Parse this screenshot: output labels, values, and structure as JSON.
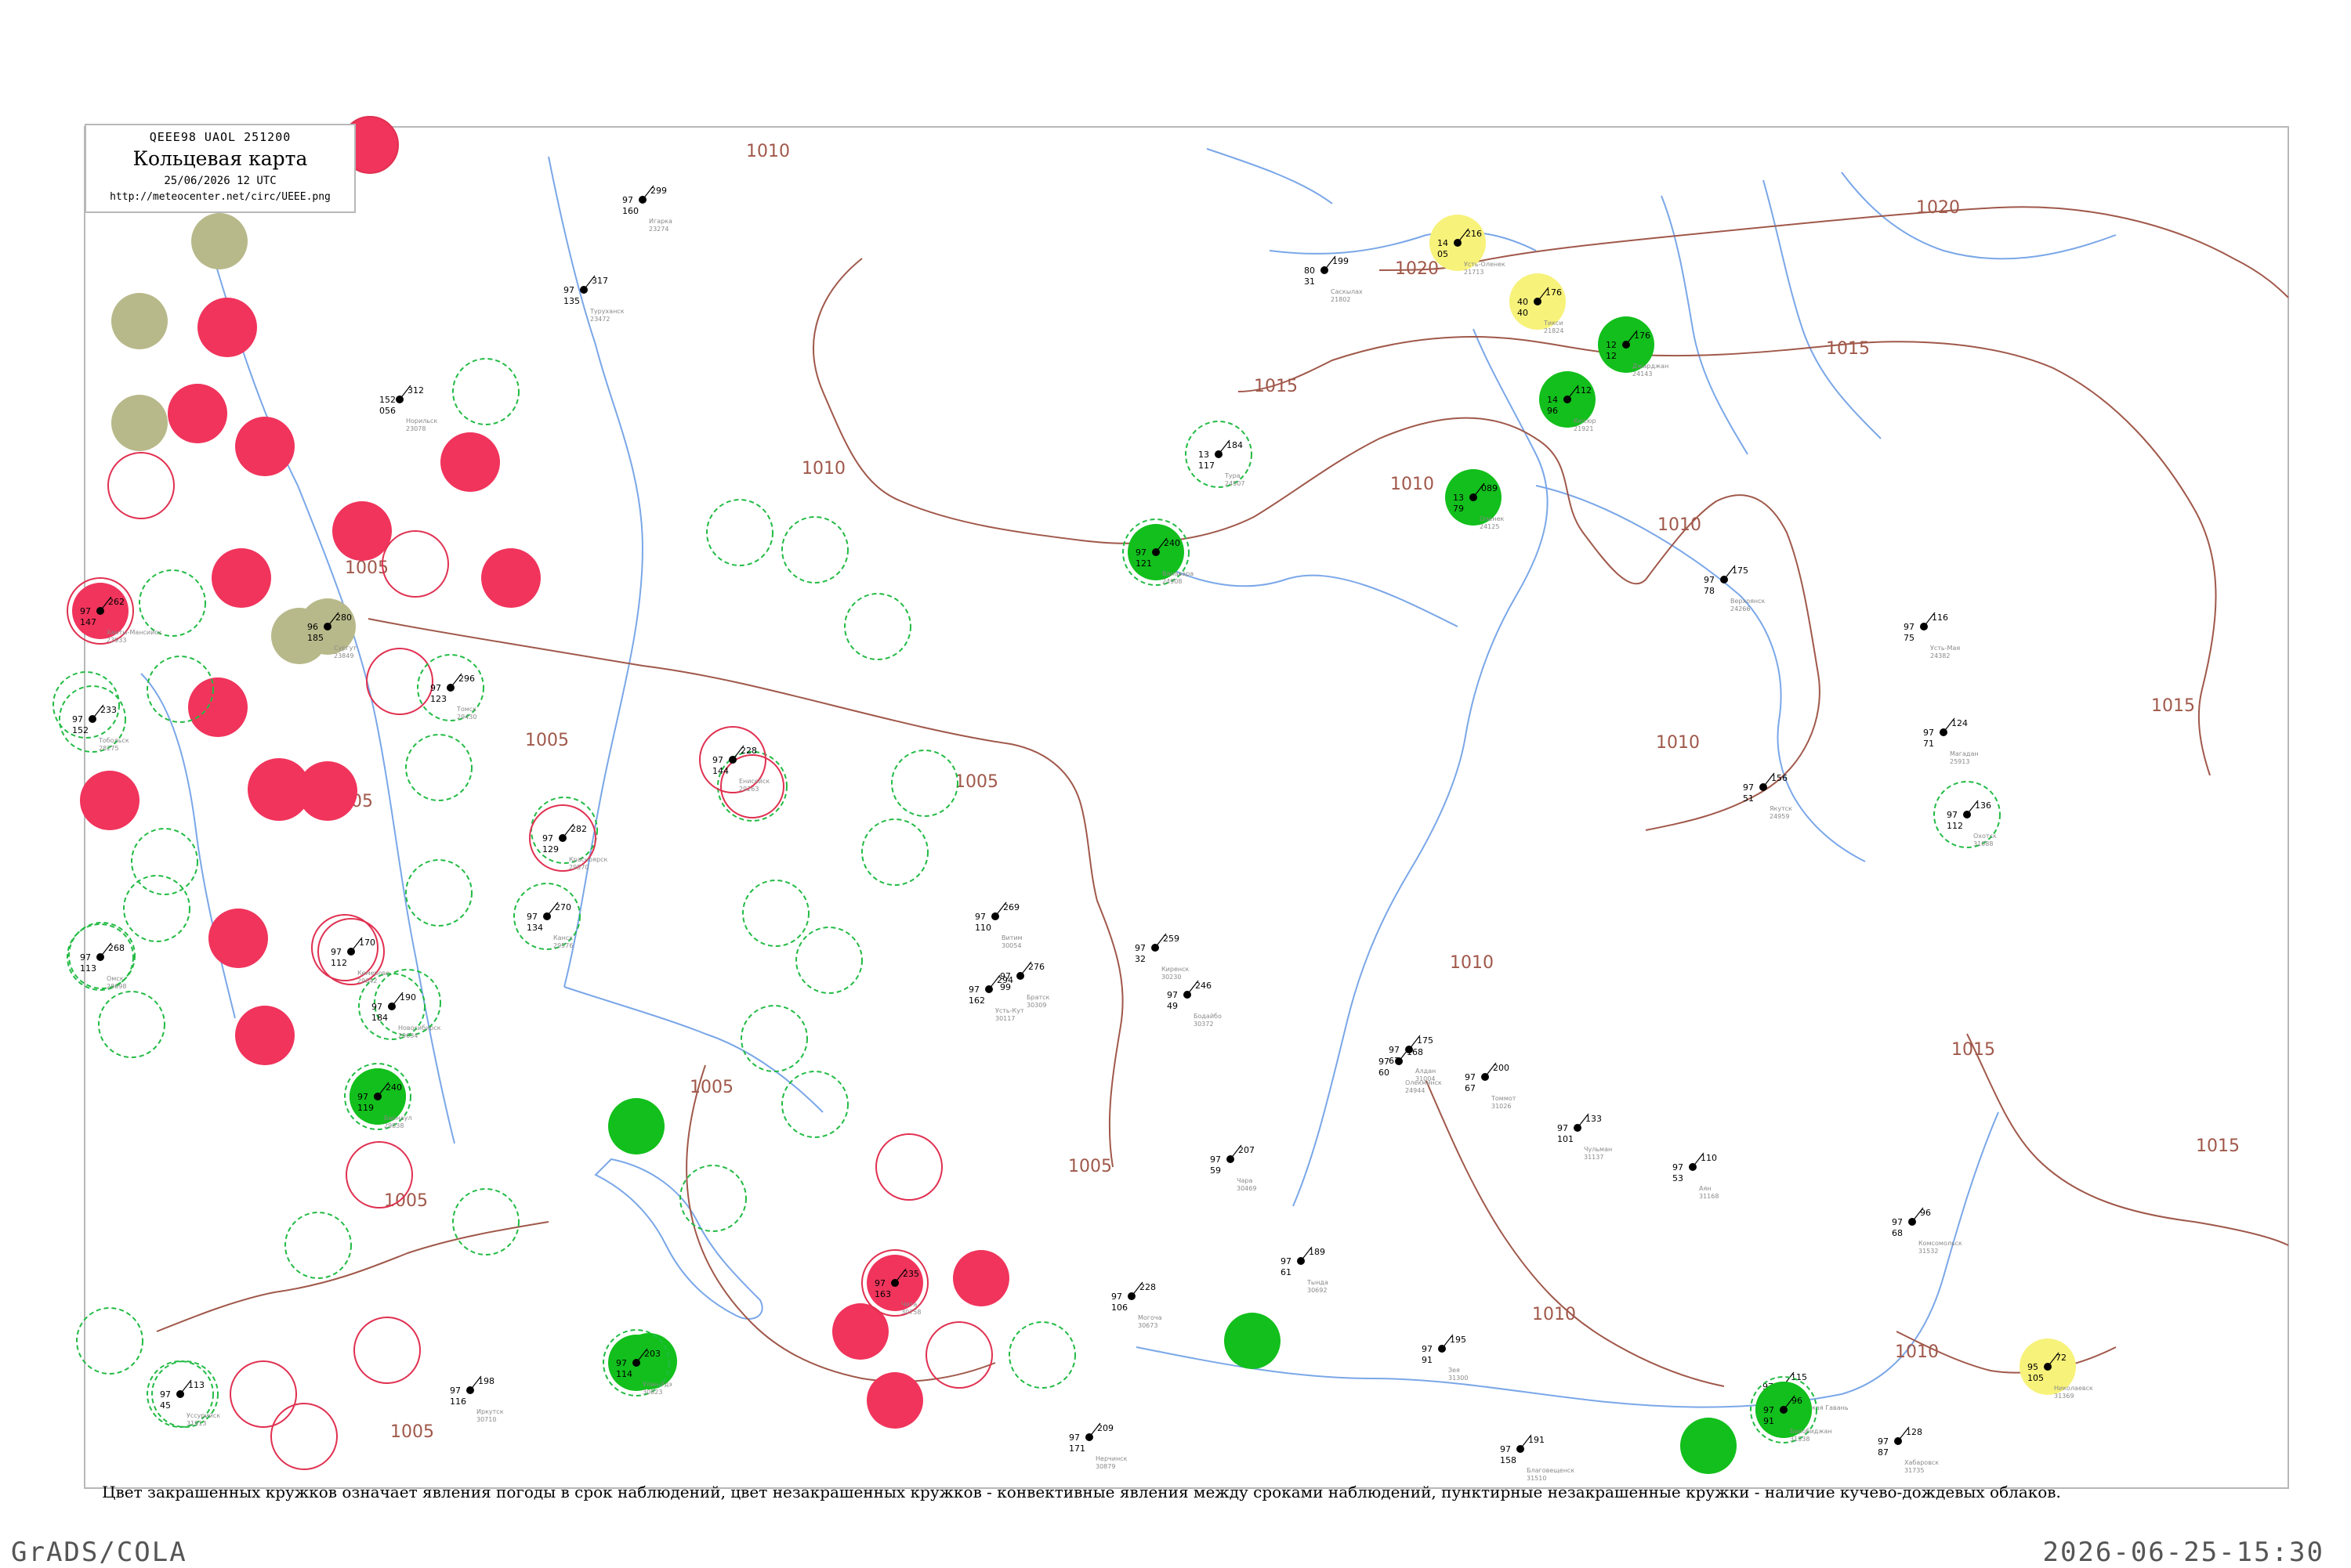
{
  "header": {
    "code_line": "QEEE98  UAOL  251200",
    "title": "Кольцевая карта",
    "date": "25/06/2026 12 UTC",
    "url": "http://meteocenter.net/circ/UEEE.png"
  },
  "caption": "Цвет закрашенных кружков означает явления погоды в срок наблюдений, цвет незакрашенных кружков - конвективные явления между сроками наблюдений, пунктирные незакрашенные кружки - наличие кучево-дождевых облаков.",
  "footer": {
    "left": "GrADS/COLA",
    "right": "2026-06-25-15:30"
  },
  "colors": {
    "isobar": "#a0584a",
    "river": "#7aa7e8",
    "thunder_fill": "#f0345c",
    "rain_fill": "#12bf1c",
    "haze_fill": "#b8b98a",
    "fog_fill": "#f7f27a",
    "cb_ring": "#22bb44",
    "conv_ring": "#e03050",
    "frame": "#b8b8b8"
  },
  "isobar_labels": [
    "1005",
    "1005",
    "1005",
    "1005",
    "1005",
    "1005",
    "1005",
    "1005",
    "1010",
    "1010",
    "1010",
    "1010",
    "1010",
    "1010",
    "1010",
    "1010",
    "1010",
    "1010",
    "1015",
    "1015",
    "1015",
    "1015",
    "1015",
    "1020",
    "1020"
  ],
  "stations": [
    {
      "name": "Саскылах",
      "id": "21802",
      "pres": "199",
      "temp": "80",
      "dew": "31",
      "fill": "none",
      "ring": "none"
    },
    {
      "name": "Усть-Оленек",
      "id": "21713",
      "pres": "216",
      "temp": "14",
      "dew": "05",
      "fill": "fog",
      "ring": "none"
    },
    {
      "name": "Тикси",
      "id": "21824",
      "pres": "176",
      "temp": "40",
      "dew": "40",
      "fill": "fog",
      "ring": "none"
    },
    {
      "name": "Джарджан",
      "id": "24143",
      "pres": "176",
      "temp": "12",
      "dew": "12",
      "fill": "rain",
      "ring": "none"
    },
    {
      "name": "Кюсюр",
      "id": "21921",
      "pres": "112",
      "temp": "14",
      "dew": "96",
      "fill": "rain",
      "ring": "none"
    },
    {
      "name": "Оленек",
      "id": "24125",
      "pres": "089",
      "temp": "13",
      "dew": "79",
      "fill": "rain",
      "ring": "none"
    },
    {
      "name": "Тура",
      "id": "24507",
      "pres": "184",
      "temp": "13",
      "dew": "117",
      "fill": "none",
      "ring": "cb"
    },
    {
      "name": "Ванавара",
      "id": "24908",
      "pres": "240",
      "temp": "97",
      "dew": "121",
      "fill": "rain",
      "ring": "cb"
    },
    {
      "name": "Верхоянск",
      "id": "24266",
      "pres": "175",
      "temp": "97",
      "dew": "78",
      "fill": "none",
      "ring": "none"
    },
    {
      "name": "Усть-Мая",
      "id": "24382",
      "pres": "116",
      "temp": "97",
      "dew": "75",
      "fill": "none",
      "ring": "none"
    },
    {
      "name": "Якутск",
      "id": "24959",
      "pres": "156",
      "temp": "97",
      "dew": "51",
      "fill": "none",
      "ring": "none"
    },
    {
      "name": "Олекминск",
      "id": "24944",
      "pres": "168",
      "temp": "97",
      "dew": "60",
      "fill": "none",
      "ring": "none"
    },
    {
      "name": "Витим",
      "id": "30054",
      "pres": "269",
      "temp": "97",
      "dew": "110",
      "fill": "none",
      "ring": "none"
    },
    {
      "name": "Киренск",
      "id": "30230",
      "pres": "259",
      "temp": "97",
      "dew": "32",
      "fill": "none",
      "ring": "none"
    },
    {
      "name": "Бодайбо",
      "id": "30372",
      "pres": "246",
      "temp": "97",
      "dew": "49",
      "fill": "none",
      "ring": "none"
    },
    {
      "name": "Чара",
      "id": "30469",
      "pres": "207",
      "temp": "97",
      "dew": "59",
      "fill": "none",
      "ring": "none"
    },
    {
      "name": "Алдан",
      "id": "31004",
      "pres": "175",
      "temp": "97",
      "dew": "67",
      "fill": "none",
      "ring": "none"
    },
    {
      "name": "Томмот",
      "id": "31026",
      "pres": "200",
      "temp": "97",
      "dew": "67",
      "fill": "none",
      "ring": "none"
    },
    {
      "name": "Чульман",
      "id": "31137",
      "pres": "133",
      "temp": "97",
      "dew": "101",
      "fill": "none",
      "ring": "none"
    },
    {
      "name": "Аян",
      "id": "31168",
      "pres": "110",
      "temp": "97",
      "dew": "53",
      "fill": "none",
      "ring": "none"
    },
    {
      "name": "Охотск",
      "id": "31088",
      "pres": "136",
      "temp": "97",
      "dew": "112",
      "fill": "none",
      "ring": "cb"
    },
    {
      "name": "Магадан",
      "id": "25913",
      "pres": "124",
      "temp": "97",
      "dew": "71",
      "fill": "none",
      "ring": "none"
    },
    {
      "name": "Николаевск",
      "id": "31369",
      "pres": "72",
      "temp": "95",
      "dew": "105",
      "fill": "fog",
      "ring": "none"
    },
    {
      "name": "Норильск",
      "id": "23078",
      "pres": "312",
      "temp": "152",
      "dew": "056",
      "fill": "none",
      "ring": "none"
    },
    {
      "name": "Игарка",
      "id": "23274",
      "pres": "299",
      "temp": "97",
      "dew": "160",
      "fill": "none",
      "ring": "none"
    },
    {
      "name": "Туруханск",
      "id": "23472",
      "pres": "317",
      "temp": "97",
      "dew": "135",
      "fill": "none",
      "ring": "none"
    },
    {
      "name": "Ханты-Мансийск",
      "id": "23933",
      "pres": "262",
      "temp": "97",
      "dew": "147",
      "fill": "thunder",
      "ring": "conv"
    },
    {
      "name": "Сургут",
      "id": "23849",
      "pres": "280",
      "temp": "96",
      "dew": "185",
      "fill": "haze",
      "ring": "none"
    },
    {
      "name": "Тобольск",
      "id": "28275",
      "pres": "233",
      "temp": "97",
      "dew": "152",
      "fill": "none",
      "ring": "cb"
    },
    {
      "name": "Омск",
      "id": "28698",
      "pres": "268",
      "temp": "97",
      "dew": "113",
      "fill": "none",
      "ring": "cb"
    },
    {
      "name": "Новосибирск",
      "id": "29634",
      "pres": "190",
      "temp": "97",
      "dew": "184",
      "fill": "none",
      "ring": "cb"
    },
    {
      "name": "Барнаул",
      "id": "29838",
      "pres": "240",
      "temp": "97",
      "dew": "119",
      "fill": "rain",
      "ring": "cb"
    },
    {
      "name": "Кемерово",
      "id": "29642",
      "pres": "170",
      "temp": "97",
      "dew": "112",
      "fill": "none",
      "ring": "conv"
    },
    {
      "name": "Томск",
      "id": "29430",
      "pres": "296",
      "temp": "97",
      "dew": "123",
      "fill": "none",
      "ring": "cb"
    },
    {
      "name": "Красноярск",
      "id": "29570",
      "pres": "282",
      "temp": "97",
      "dew": "129",
      "fill": "none",
      "ring": "conv"
    },
    {
      "name": "Канск",
      "id": "29576",
      "pres": "270",
      "temp": "97",
      "dew": "134",
      "fill": "none",
      "ring": "cb"
    },
    {
      "name": "Енисейск",
      "id": "29263",
      "pres": "228",
      "temp": "97",
      "dew": "144",
      "fill": "none",
      "ring": "conv"
    },
    {
      "name": "Иркутск",
      "id": "30710",
      "pres": "198",
      "temp": "97",
      "dew": "116",
      "fill": "none",
      "ring": "none"
    },
    {
      "name": "Улан-Удэ",
      "id": "30823",
      "pres": "203",
      "temp": "97",
      "dew": "114",
      "fill": "rain",
      "ring": "cb"
    },
    {
      "name": "Чита",
      "id": "30758",
      "pres": "235",
      "temp": "97",
      "dew": "163",
      "fill": "thunder",
      "ring": "conv"
    },
    {
      "name": "Братск",
      "id": "30309",
      "pres": "276",
      "temp": "97",
      "dew": "99",
      "fill": "none",
      "ring": "none"
    },
    {
      "name": "Усть-Кут",
      "id": "30117",
      "pres": "294",
      "temp": "97",
      "dew": "162",
      "fill": "none",
      "ring": "none"
    },
    {
      "name": "Нерчинск",
      "id": "30879",
      "pres": "209",
      "temp": "97",
      "dew": "171",
      "fill": "none",
      "ring": "none"
    },
    {
      "name": "Могоча",
      "id": "30673",
      "pres": "228",
      "temp": "97",
      "dew": "106",
      "fill": "none",
      "ring": "none"
    },
    {
      "name": "Тында",
      "id": "30692",
      "pres": "189",
      "temp": "97",
      "dew": "61",
      "fill": "none",
      "ring": "none"
    },
    {
      "name": "Зея",
      "id": "31300",
      "pres": "195",
      "temp": "97",
      "dew": "91",
      "fill": "none",
      "ring": "none"
    },
    {
      "name": "Благовещенск",
      "id": "31510",
      "pres": "191",
      "temp": "97",
      "dew": "158",
      "fill": "none",
      "ring": "none"
    },
    {
      "name": "Хабаровск",
      "id": "31735",
      "pres": "128",
      "temp": "97",
      "dew": "87",
      "fill": "none",
      "ring": "none"
    },
    {
      "name": "Комсомольск",
      "id": "31532",
      "pres": "96",
      "temp": "97",
      "dew": "68",
      "fill": "none",
      "ring": "none"
    },
    {
      "name": "Советская Гавань",
      "id": "31736",
      "pres": "115",
      "temp": "97",
      "dew": "85",
      "fill": "none",
      "ring": "none"
    },
    {
      "name": "Биробиджан",
      "id": "31538",
      "pres": "96",
      "temp": "97",
      "dew": "91",
      "fill": "rain",
      "ring": "cb"
    },
    {
      "name": "Уссурийск",
      "id": "31913",
      "pres": "113",
      "temp": "97",
      "dew": "45",
      "fill": "none",
      "ring": "cb"
    }
  ]
}
